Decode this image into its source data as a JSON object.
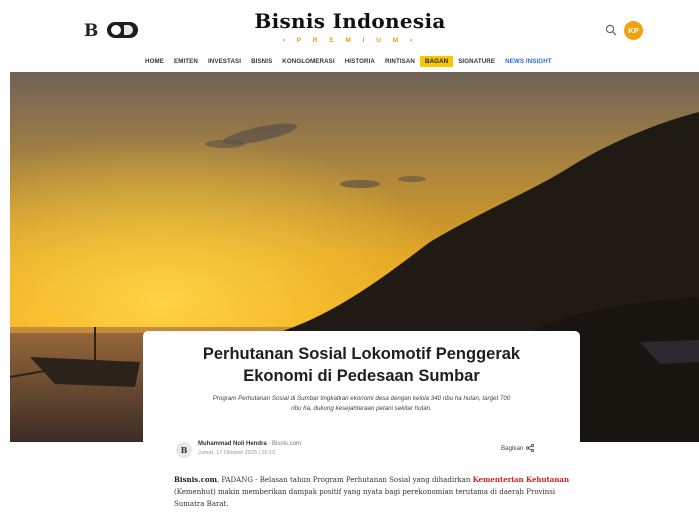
{
  "header": {
    "mini_logo": "B",
    "logo": "Bisnis Indonesia",
    "premium": "• P R E M I U M •",
    "avatar_initials": "KP"
  },
  "nav": {
    "items": [
      {
        "label": "HOME"
      },
      {
        "label": "EMITEN"
      },
      {
        "label": "INVESTASI"
      },
      {
        "label": "BISNIS"
      },
      {
        "label": "KONGLOMERASI"
      },
      {
        "label": "HISTORIA"
      },
      {
        "label": "RINTISAN"
      },
      {
        "label": "BAGAN"
      },
      {
        "label": "SIGNATURE"
      },
      {
        "label": "NEWS INSIGHT"
      }
    ]
  },
  "article": {
    "title_line1": "Perhutanan Sosial Lokomotif Penggerak",
    "title_line2": "Ekonomi di Pedesaan Sumbar",
    "subtitle_line1": "Program Perhutanan Sosial di Sumbar tingkatkan ekonomi desa dengan kelola 340 ribu ha hutan, target 700",
    "subtitle_line2": "ribu ha, dukung kesejahteraan petani sekitar hutan.",
    "author_logo": "B",
    "author": "Muhammad Noli Hendra",
    "source": " - Bisnis.com",
    "date": "Jumat, 17 Oktober 2025 | 20:10",
    "share_label": "Bagikan",
    "body_source": "Bisnis.com",
    "body_part1": ", PADANG - Belasan tahun Program Perhutanan Sosial yang dihadirkan ",
    "body_link": "Kementerian Kehutanan",
    "body_part2": " (Kemenhut) makin memberikan dampak positif yang nyata bagi perekonomian terutama di daerah Provinsi Sumatra Barat."
  },
  "colors": {
    "accent": "#f7c800",
    "avatar": "#f2a20f",
    "link_red": "#d11f1f",
    "nav_blue": "#2b6bd1"
  }
}
